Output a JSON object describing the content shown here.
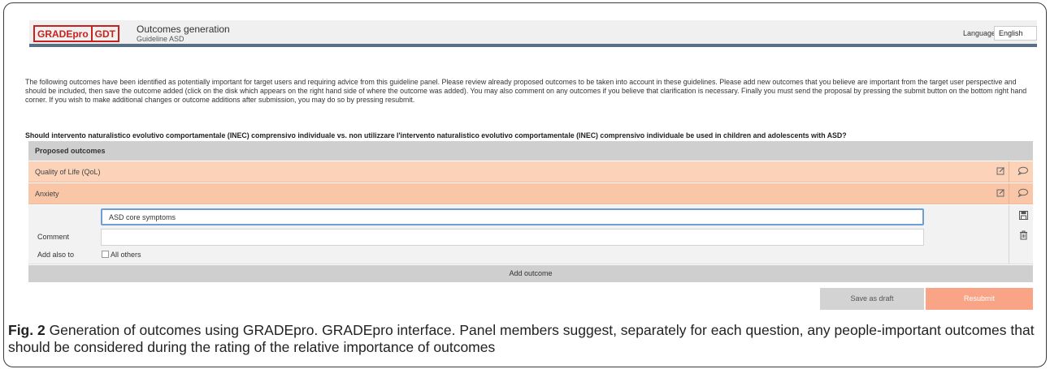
{
  "header": {
    "logo_pro": "GRADEpro",
    "logo_gdt": "GDT",
    "title": "Outcomes generation",
    "subtitle": "Guideline ASD",
    "language_label": "Language",
    "language_value": "English",
    "brand_color": "#c8211e"
  },
  "intro": {
    "text": "The following outcomes have been identified as potentially important for target users and requiring advice from this guideline panel. Please review already proposed outcomes to be taken into account in these guidelines. Please add new outcomes that you believe are important from the target user perspective and should be included, then save the outcome added (click on the disk which appears on the right hand side of where the outcome was added). You may also comment on any outcomes if you believe that clarification is necessary. Finally you must send the proposal by pressing the submit button on the bottom right hand corner. If you wish to make additional changes or outcome additions after submission, you may do so by pressing resubmit."
  },
  "question": "Should intervento naturalistico evolutivo comportamentale (INEC) comprensivo individuale vs. non utilizzare l'intervento naturalistico evolutivo comportamentale (INEC) comprensivo individuale be used in children and adolescents with ASD?",
  "proposed": {
    "header": "Proposed outcomes",
    "outcomes": [
      {
        "label": "Quality of Life (QoL)"
      },
      {
        "label": "Anxiety"
      }
    ],
    "row_color": "#fcd2b8"
  },
  "new_outcome": {
    "value": "ASD core symptoms",
    "comment_label": "Comment",
    "comment_value": "",
    "add_also_label": "Add also to",
    "all_others_label": "All others"
  },
  "buttons": {
    "add_outcome": "Add outcome",
    "save_draft": "Save as draft",
    "resubmit": "Resubmit",
    "resubmit_color": "#f9a486"
  },
  "icons": {
    "edit": "edit-icon",
    "comment": "comment-icon",
    "save": "floppy-disk-icon",
    "delete": "trash-icon"
  },
  "caption": {
    "label": "Fig. 2",
    "text": " Generation of outcomes using GRADEpro. GRADEpro interface. Panel members suggest, separately for each question, any people-important outcomes that should be considered during the rating of the relative importance of outcomes"
  }
}
